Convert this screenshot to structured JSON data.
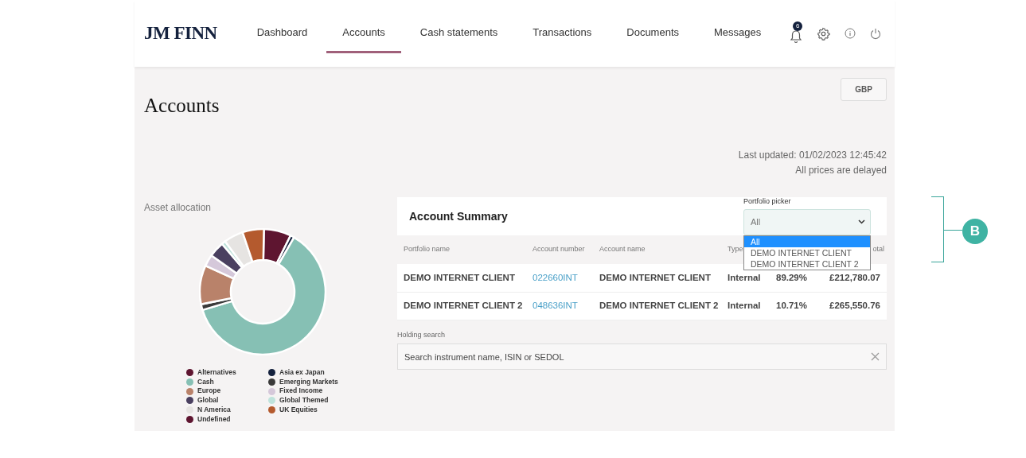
{
  "header": {
    "logo": "JM FINN",
    "nav": [
      {
        "label": "Dashboard",
        "selected": false
      },
      {
        "label": "Accounts",
        "selected": true
      },
      {
        "label": "Cash statements",
        "selected": false
      },
      {
        "label": "Transactions",
        "selected": false
      },
      {
        "label": "Documents",
        "selected": false
      },
      {
        "label": "Messages",
        "selected": false
      }
    ],
    "notification_count": "6"
  },
  "page": {
    "title": "Accounts",
    "currency_button": "GBP",
    "last_updated": "Last updated: 01/02/2023 12:45:42",
    "price_note": "All prices are delayed"
  },
  "asset_allocation": {
    "title": "Asset allocation",
    "legend": [
      {
        "label": "Alternatives",
        "color": "#5e1530"
      },
      {
        "label": "Asia ex Japan",
        "color": "#14213d"
      },
      {
        "label": "Cash",
        "color": "#86c0b4"
      },
      {
        "label": "Emerging Markets",
        "color": "#3a3a3a"
      },
      {
        "label": "Europe",
        "color": "#b9826a"
      },
      {
        "label": "Fixed Income",
        "color": "#d5c8da"
      },
      {
        "label": "Global",
        "color": "#4a4060"
      },
      {
        "label": "Global Themed",
        "color": "#bfe3dc"
      },
      {
        "label": "N America",
        "color": "#e6e4e2"
      },
      {
        "label": "UK Equities",
        "color": "#b45a2e"
      },
      {
        "label": "Undefined",
        "color": "#5e1530"
      }
    ]
  },
  "account_summary": {
    "title": "Account Summary",
    "picker": {
      "label": "Portfolio picker",
      "value": "All",
      "options": [
        {
          "label": "All",
          "selected": true
        },
        {
          "label": "DEMO INTERNET CLIENT",
          "selected": false
        },
        {
          "label": "DEMO INTERNET CLIENT 2",
          "selected": false
        }
      ]
    },
    "columns": [
      "Portfolio name",
      "Account number",
      "Account name",
      "Type",
      "",
      "otal"
    ],
    "rows": [
      [
        "DEMO INTERNET CLIENT",
        "022660INT",
        "DEMO INTERNET CLIENT",
        "Internal",
        "89.29%",
        "£212,780.07"
      ],
      [
        "DEMO INTERNET CLIENT 2",
        "048636INT",
        "DEMO INTERNET CLIENT 2",
        "Internal",
        "10.71%",
        "£265,550.76"
      ]
    ]
  },
  "holding_search": {
    "label": "Holding search",
    "placeholder": "Search instrument name, ISIN or SEDOL"
  },
  "callout": {
    "label": "B"
  }
}
